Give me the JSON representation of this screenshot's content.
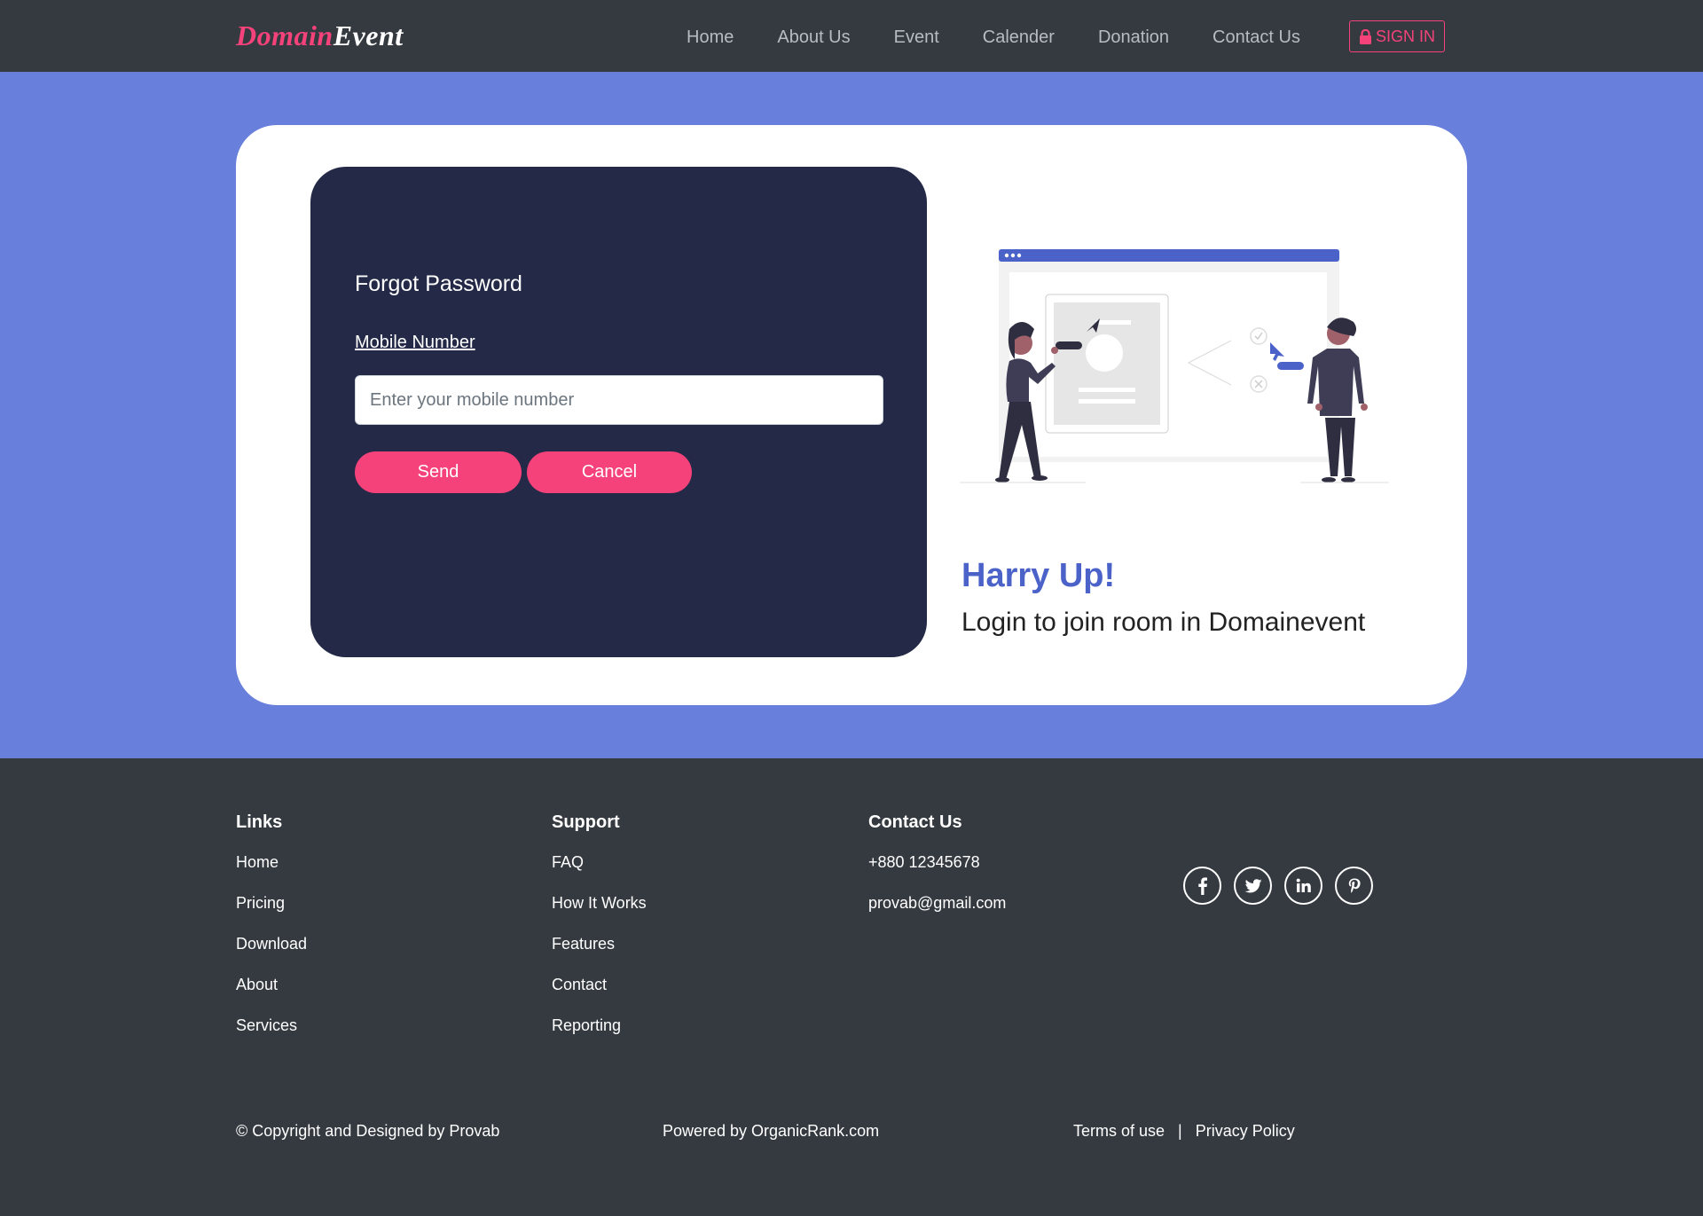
{
  "brand": {
    "part1": "Domain",
    "part2": "Event"
  },
  "nav": {
    "items": [
      "Home",
      "About Us",
      "Event",
      "Calender",
      "Donation",
      "Contact Us"
    ],
    "signin_label": "SIGN IN"
  },
  "form": {
    "title": "Forgot Password",
    "field_label": "Mobile Number",
    "mobile_value": "",
    "mobile_placeholder": "Enter your mobile number",
    "send_label": "Send",
    "cancel_label": "Cancel"
  },
  "promo": {
    "heading": "Harry Up!",
    "text": "Login to join room in Domainevent"
  },
  "footer": {
    "links": {
      "heading": "Links",
      "items": [
        "Home",
        "Pricing",
        "Download",
        "About",
        "Services"
      ]
    },
    "support": {
      "heading": "Support",
      "items": [
        "FAQ",
        "How It Works",
        "Features",
        "Contact",
        "Reporting"
      ]
    },
    "contact": {
      "heading": "Contact Us",
      "phone": "+880 12345678",
      "email": "provab@gmail.com"
    },
    "social_icons": [
      "facebook-icon",
      "twitter-icon",
      "linkedin-icon",
      "pinterest-icon"
    ],
    "copyright": "© Copyright and Designed by Provab",
    "powered": "Powered by OrganicRank.com",
    "terms": "Terms of use",
    "separator": "|",
    "privacy": "Privacy Policy"
  },
  "colors": {
    "navbar_bg": "#343a40",
    "hero_bg": "#6880dc",
    "panel_bg": "#232946",
    "accent_pink": "#f5427a",
    "heading_blue": "#4b63c9"
  }
}
